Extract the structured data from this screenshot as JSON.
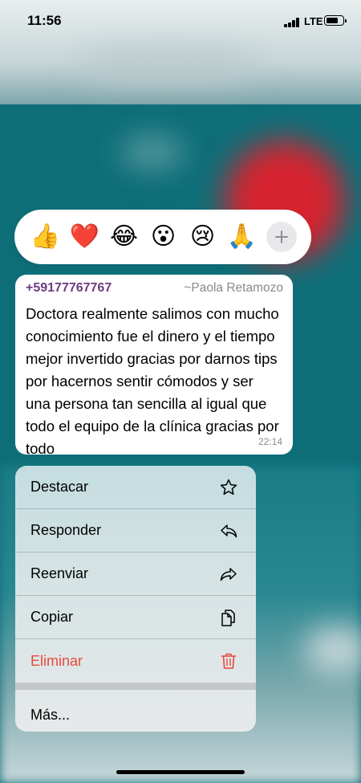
{
  "status_bar": {
    "time": "11:56",
    "network": "LTE"
  },
  "reactions": {
    "items": [
      {
        "emoji": "👍",
        "name": "thumbs-up"
      },
      {
        "emoji": "❤️",
        "name": "heart"
      },
      {
        "emoji": "😂",
        "name": "tears-of-joy"
      },
      {
        "emoji": "😮",
        "name": "surprised"
      },
      {
        "emoji": "😢",
        "name": "crying"
      },
      {
        "emoji": "🙏",
        "name": "folded-hands"
      }
    ],
    "add_icon": "plus-icon"
  },
  "message": {
    "sender_phone": "+59177767767",
    "sender_name": "~Paola Retamozo",
    "text": "Doctora realmente salimos con mucho conocimiento fue el dinero y el tiempo mejor invertido gracias por darnos tips por hacernos sentir cómodos y ser una persona tan sencilla al igual que todo el equipo de la clínica gracias por todo",
    "time": "22:14"
  },
  "menu": {
    "items": [
      {
        "label": "Destacar",
        "icon": "star-icon"
      },
      {
        "label": "Responder",
        "icon": "reply-icon"
      },
      {
        "label": "Reenviar",
        "icon": "forward-icon"
      },
      {
        "label": "Copiar",
        "icon": "copy-icon"
      },
      {
        "label": "Eliminar",
        "icon": "trash-icon"
      }
    ],
    "more_label": "Más...",
    "destructive_color": "#e84a3c"
  }
}
